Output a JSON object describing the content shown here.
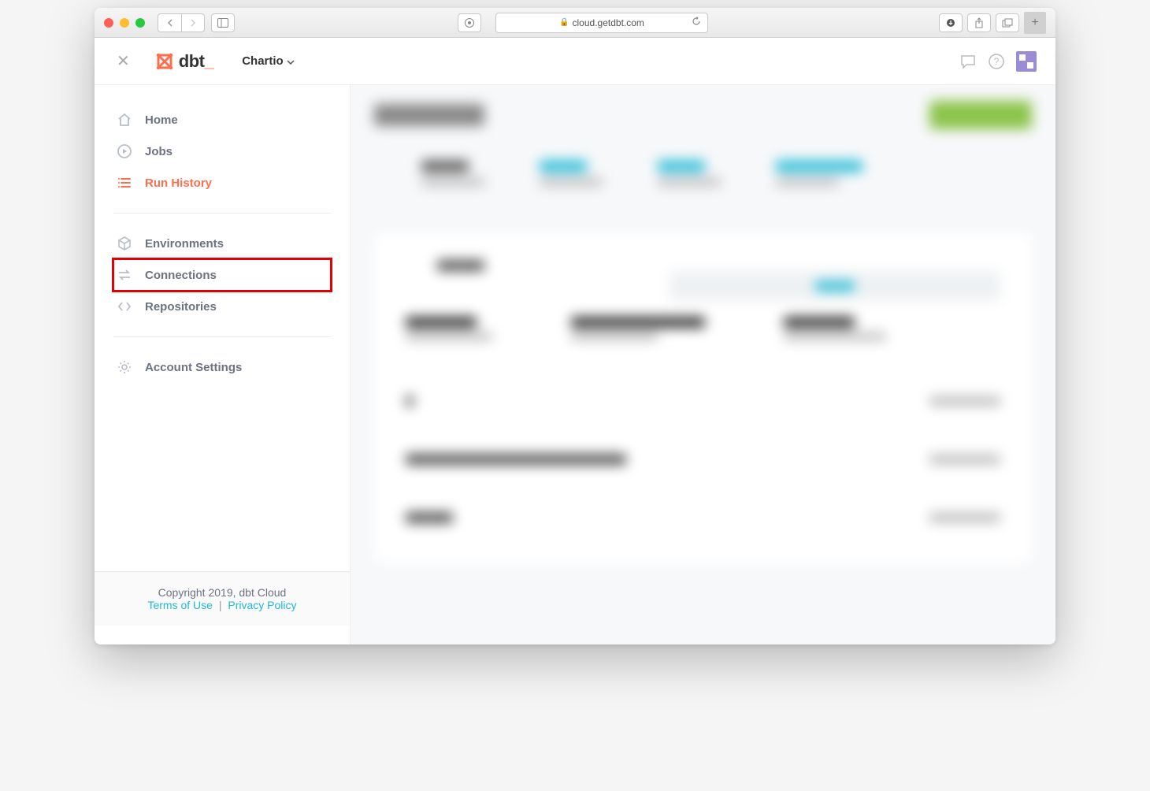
{
  "browser": {
    "url": "cloud.getdbt.com"
  },
  "header": {
    "logo_text": "dbt",
    "account_name": "Chartio"
  },
  "sidebar": {
    "items": [
      {
        "label": "Home",
        "icon": "home-icon",
        "active": false,
        "highlighted": false
      },
      {
        "label": "Jobs",
        "icon": "play-icon",
        "active": false,
        "highlighted": false
      },
      {
        "label": "Run History",
        "icon": "list-icon",
        "active": true,
        "highlighted": false
      }
    ],
    "items2": [
      {
        "label": "Environments",
        "icon": "cube-icon",
        "active": false,
        "highlighted": false
      },
      {
        "label": "Connections",
        "icon": "arrows-icon",
        "active": false,
        "highlighted": true
      },
      {
        "label": "Repositories",
        "icon": "code-icon",
        "active": false,
        "highlighted": false
      }
    ],
    "items3": [
      {
        "label": "Account Settings",
        "icon": "gear-icon",
        "active": false,
        "highlighted": false
      }
    ]
  },
  "footer": {
    "copyright": "Copyright 2019, dbt Cloud",
    "terms": "Terms of Use",
    "privacy": "Privacy Policy"
  }
}
